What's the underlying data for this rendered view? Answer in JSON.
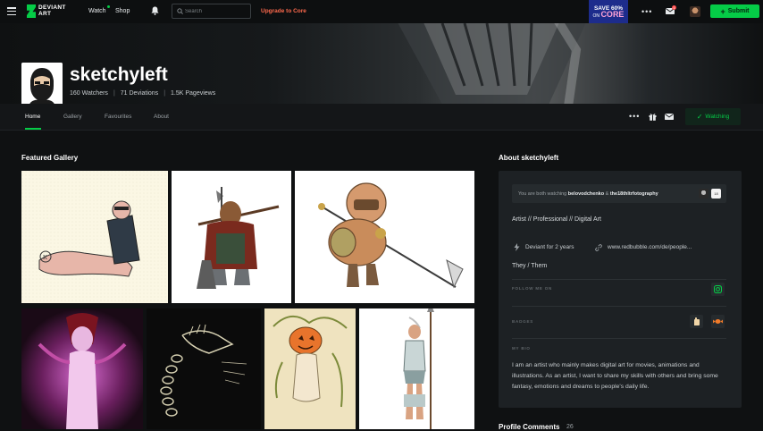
{
  "topbar": {
    "logo_text_line1": "DEVIANT",
    "logo_text_line2": "ART",
    "nav_watch": "Watch",
    "nav_shop": "Shop",
    "search_placeholder": "Search",
    "upgrade_label": "Upgrade to Core",
    "promo_line1": "SAVE 60%",
    "promo_line2_prefix": "ON",
    "promo_line2_brand": "CORE",
    "mail_badge": "1",
    "submit_label": "Submit",
    "icons": [
      "hamburger-icon",
      "bell-icon",
      "search-icon",
      "more-icon",
      "mail-icon",
      "user-avatar"
    ]
  },
  "profile": {
    "username": "sketchyleft",
    "watchers": "160 Watchers",
    "deviations": "71 Deviations",
    "pageviews": "1.5K Pageviews"
  },
  "subnav": {
    "tabs": [
      {
        "label": "Home",
        "active": true
      },
      {
        "label": "Gallery",
        "active": false
      },
      {
        "label": "Favourites",
        "active": false
      },
      {
        "label": "About",
        "active": false
      }
    ],
    "watching_label": "Watching"
  },
  "featured": {
    "title": "Featured Gallery",
    "items": [
      {
        "name": "reclining-man-sketch"
      },
      {
        "name": "dwarf-warrior"
      },
      {
        "name": "armored-knight"
      },
      {
        "name": "demon-woman"
      },
      {
        "name": "chained-crocodile"
      },
      {
        "name": "pumpkin-head-figure"
      },
      {
        "name": "spear-warrior-woman"
      }
    ]
  },
  "about": {
    "title": "About sketchyleft",
    "both_watching_prefix": "You are both watching",
    "both_watching_user1": "belovodchenko",
    "both_watching_amp": "&",
    "both_watching_user2": "the18thltrfotography",
    "tagline": "Artist  //  Professional  //  Digital Art",
    "deviant_for": "Deviant for 2 years",
    "link": "www.redbubble.com/de/people...",
    "pronouns": "They / Them",
    "follow_label": "FOLLOW ME ON",
    "badges_label": "BADGES",
    "bio_label": "MY BIO",
    "bio": "I am an artist who mainly makes digital art for movies, animations and illustrations. As an artist, I want to share my skills with others and bring some fantasy, emotions and dreams to people's daily life."
  },
  "comments": {
    "title": "Profile Comments",
    "count": "26"
  },
  "colors": {
    "accent": "#05cc47",
    "upgrade": "#ff6a4d",
    "promo_bg": "#1d2c8c",
    "page_bg": "#0f1112",
    "card_bg": "#1d2124"
  }
}
